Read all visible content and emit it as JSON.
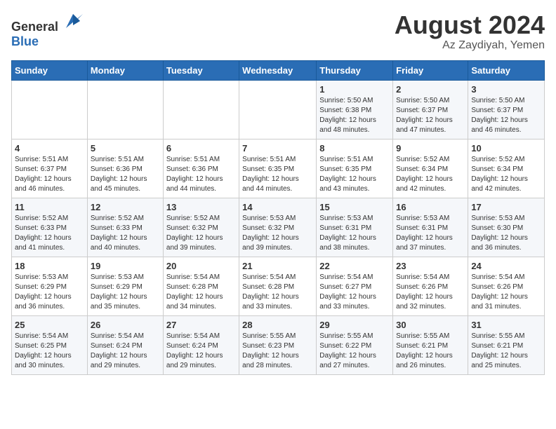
{
  "header": {
    "logo_general": "General",
    "logo_blue": "Blue",
    "month_year": "August 2024",
    "location": "Az Zaydiyah, Yemen"
  },
  "days_of_week": [
    "Sunday",
    "Monday",
    "Tuesday",
    "Wednesday",
    "Thursday",
    "Friday",
    "Saturday"
  ],
  "weeks": [
    [
      {
        "day": "",
        "info": ""
      },
      {
        "day": "",
        "info": ""
      },
      {
        "day": "",
        "info": ""
      },
      {
        "day": "",
        "info": ""
      },
      {
        "day": "1",
        "info": "Sunrise: 5:50 AM\nSunset: 6:38 PM\nDaylight: 12 hours\nand 48 minutes."
      },
      {
        "day": "2",
        "info": "Sunrise: 5:50 AM\nSunset: 6:37 PM\nDaylight: 12 hours\nand 47 minutes."
      },
      {
        "day": "3",
        "info": "Sunrise: 5:50 AM\nSunset: 6:37 PM\nDaylight: 12 hours\nand 46 minutes."
      }
    ],
    [
      {
        "day": "4",
        "info": "Sunrise: 5:51 AM\nSunset: 6:37 PM\nDaylight: 12 hours\nand 46 minutes."
      },
      {
        "day": "5",
        "info": "Sunrise: 5:51 AM\nSunset: 6:36 PM\nDaylight: 12 hours\nand 45 minutes."
      },
      {
        "day": "6",
        "info": "Sunrise: 5:51 AM\nSunset: 6:36 PM\nDaylight: 12 hours\nand 44 minutes."
      },
      {
        "day": "7",
        "info": "Sunrise: 5:51 AM\nSunset: 6:35 PM\nDaylight: 12 hours\nand 44 minutes."
      },
      {
        "day": "8",
        "info": "Sunrise: 5:51 AM\nSunset: 6:35 PM\nDaylight: 12 hours\nand 43 minutes."
      },
      {
        "day": "9",
        "info": "Sunrise: 5:52 AM\nSunset: 6:34 PM\nDaylight: 12 hours\nand 42 minutes."
      },
      {
        "day": "10",
        "info": "Sunrise: 5:52 AM\nSunset: 6:34 PM\nDaylight: 12 hours\nand 42 minutes."
      }
    ],
    [
      {
        "day": "11",
        "info": "Sunrise: 5:52 AM\nSunset: 6:33 PM\nDaylight: 12 hours\nand 41 minutes."
      },
      {
        "day": "12",
        "info": "Sunrise: 5:52 AM\nSunset: 6:33 PM\nDaylight: 12 hours\nand 40 minutes."
      },
      {
        "day": "13",
        "info": "Sunrise: 5:52 AM\nSunset: 6:32 PM\nDaylight: 12 hours\nand 39 minutes."
      },
      {
        "day": "14",
        "info": "Sunrise: 5:53 AM\nSunset: 6:32 PM\nDaylight: 12 hours\nand 39 minutes."
      },
      {
        "day": "15",
        "info": "Sunrise: 5:53 AM\nSunset: 6:31 PM\nDaylight: 12 hours\nand 38 minutes."
      },
      {
        "day": "16",
        "info": "Sunrise: 5:53 AM\nSunset: 6:31 PM\nDaylight: 12 hours\nand 37 minutes."
      },
      {
        "day": "17",
        "info": "Sunrise: 5:53 AM\nSunset: 6:30 PM\nDaylight: 12 hours\nand 36 minutes."
      }
    ],
    [
      {
        "day": "18",
        "info": "Sunrise: 5:53 AM\nSunset: 6:29 PM\nDaylight: 12 hours\nand 36 minutes."
      },
      {
        "day": "19",
        "info": "Sunrise: 5:53 AM\nSunset: 6:29 PM\nDaylight: 12 hours\nand 35 minutes."
      },
      {
        "day": "20",
        "info": "Sunrise: 5:54 AM\nSunset: 6:28 PM\nDaylight: 12 hours\nand 34 minutes."
      },
      {
        "day": "21",
        "info": "Sunrise: 5:54 AM\nSunset: 6:28 PM\nDaylight: 12 hours\nand 33 minutes."
      },
      {
        "day": "22",
        "info": "Sunrise: 5:54 AM\nSunset: 6:27 PM\nDaylight: 12 hours\nand 33 minutes."
      },
      {
        "day": "23",
        "info": "Sunrise: 5:54 AM\nSunset: 6:26 PM\nDaylight: 12 hours\nand 32 minutes."
      },
      {
        "day": "24",
        "info": "Sunrise: 5:54 AM\nSunset: 6:26 PM\nDaylight: 12 hours\nand 31 minutes."
      }
    ],
    [
      {
        "day": "25",
        "info": "Sunrise: 5:54 AM\nSunset: 6:25 PM\nDaylight: 12 hours\nand 30 minutes."
      },
      {
        "day": "26",
        "info": "Sunrise: 5:54 AM\nSunset: 6:24 PM\nDaylight: 12 hours\nand 29 minutes."
      },
      {
        "day": "27",
        "info": "Sunrise: 5:54 AM\nSunset: 6:24 PM\nDaylight: 12 hours\nand 29 minutes."
      },
      {
        "day": "28",
        "info": "Sunrise: 5:55 AM\nSunset: 6:23 PM\nDaylight: 12 hours\nand 28 minutes."
      },
      {
        "day": "29",
        "info": "Sunrise: 5:55 AM\nSunset: 6:22 PM\nDaylight: 12 hours\nand 27 minutes."
      },
      {
        "day": "30",
        "info": "Sunrise: 5:55 AM\nSunset: 6:21 PM\nDaylight: 12 hours\nand 26 minutes."
      },
      {
        "day": "31",
        "info": "Sunrise: 5:55 AM\nSunset: 6:21 PM\nDaylight: 12 hours\nand 25 minutes."
      }
    ]
  ]
}
